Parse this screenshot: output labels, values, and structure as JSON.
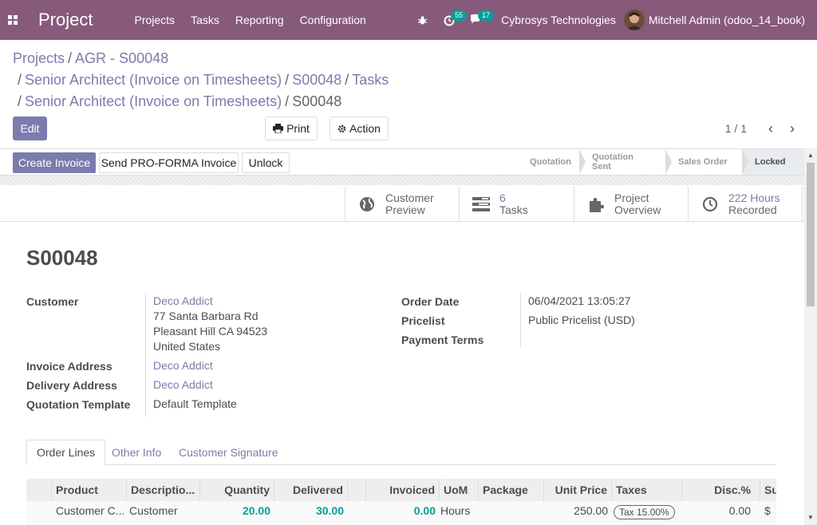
{
  "navbar": {
    "brand": "Project",
    "menu": [
      "Projects",
      "Tasks",
      "Reporting",
      "Configuration"
    ],
    "activity_count": "55",
    "message_count": "17",
    "company": "Cybrosys Technologies",
    "user": "Mitchell Admin (odoo_14_book)"
  },
  "breadcrumb": {
    "line1": [
      "Projects",
      "AGR - S00048"
    ],
    "line2": [
      "Senior Architect (Invoice on Timesheets)",
      "S00048",
      "Tasks"
    ],
    "line3_links": [
      "Senior Architect (Invoice on Timesheets)"
    ],
    "line3_current": "S00048"
  },
  "controls": {
    "edit": "Edit",
    "print": "Print",
    "action": "Action",
    "pager": "1 / 1"
  },
  "statusbar": {
    "create_invoice": "Create Invoice",
    "send_proforma": "Send PRO-FORMA Invoice",
    "unlock": "Unlock",
    "stages": [
      "Quotation",
      "Quotation Sent",
      "Sales Order",
      "Locked"
    ],
    "active_stage": "Locked"
  },
  "smart_buttons": [
    {
      "icon": "globe-icon",
      "line1": "Customer",
      "line2": "Preview"
    },
    {
      "icon": "tasks-icon",
      "line1": "6",
      "line2": "Tasks"
    },
    {
      "icon": "puzzle-icon",
      "line1": "Project",
      "line2": "Overview"
    },
    {
      "icon": "clock-icon",
      "line1": "222 Hours",
      "line2": "Recorded"
    }
  ],
  "order": {
    "name": "S00048",
    "labels": {
      "customer": "Customer",
      "invoice_address": "Invoice Address",
      "delivery_address": "Delivery Address",
      "quotation_template": "Quotation Template",
      "order_date": "Order Date",
      "pricelist": "Pricelist",
      "payment_terms": "Payment Terms"
    },
    "customer_name": "Deco Addict",
    "customer_street": "77 Santa Barbara Rd",
    "customer_city": "Pleasant Hill CA 94523",
    "customer_country": "United States",
    "invoice_address": "Deco Addict",
    "delivery_address": "Deco Addict",
    "quotation_template": "Default Template",
    "order_date": "06/04/2021 13:05:27",
    "pricelist": "Public Pricelist (USD)"
  },
  "tabs": [
    "Order Lines",
    "Other Info",
    "Customer Signature"
  ],
  "table": {
    "headers": [
      "Product",
      "Descriptio...",
      "Quantity",
      "Delivered",
      "",
      "Invoiced",
      "UoM",
      "Package",
      "Unit Price",
      "Taxes",
      "Disc.%",
      "Su"
    ],
    "rows": [
      {
        "product": "Customer C...",
        "description": "Customer",
        "quantity": "20.00",
        "delivered": "30.00",
        "invoiced": "0.00",
        "uom": "Hours",
        "unit_price": "250.00",
        "taxes": "Tax 15.00%",
        "discount": "0.00",
        "subtotal": "$"
      }
    ]
  }
}
